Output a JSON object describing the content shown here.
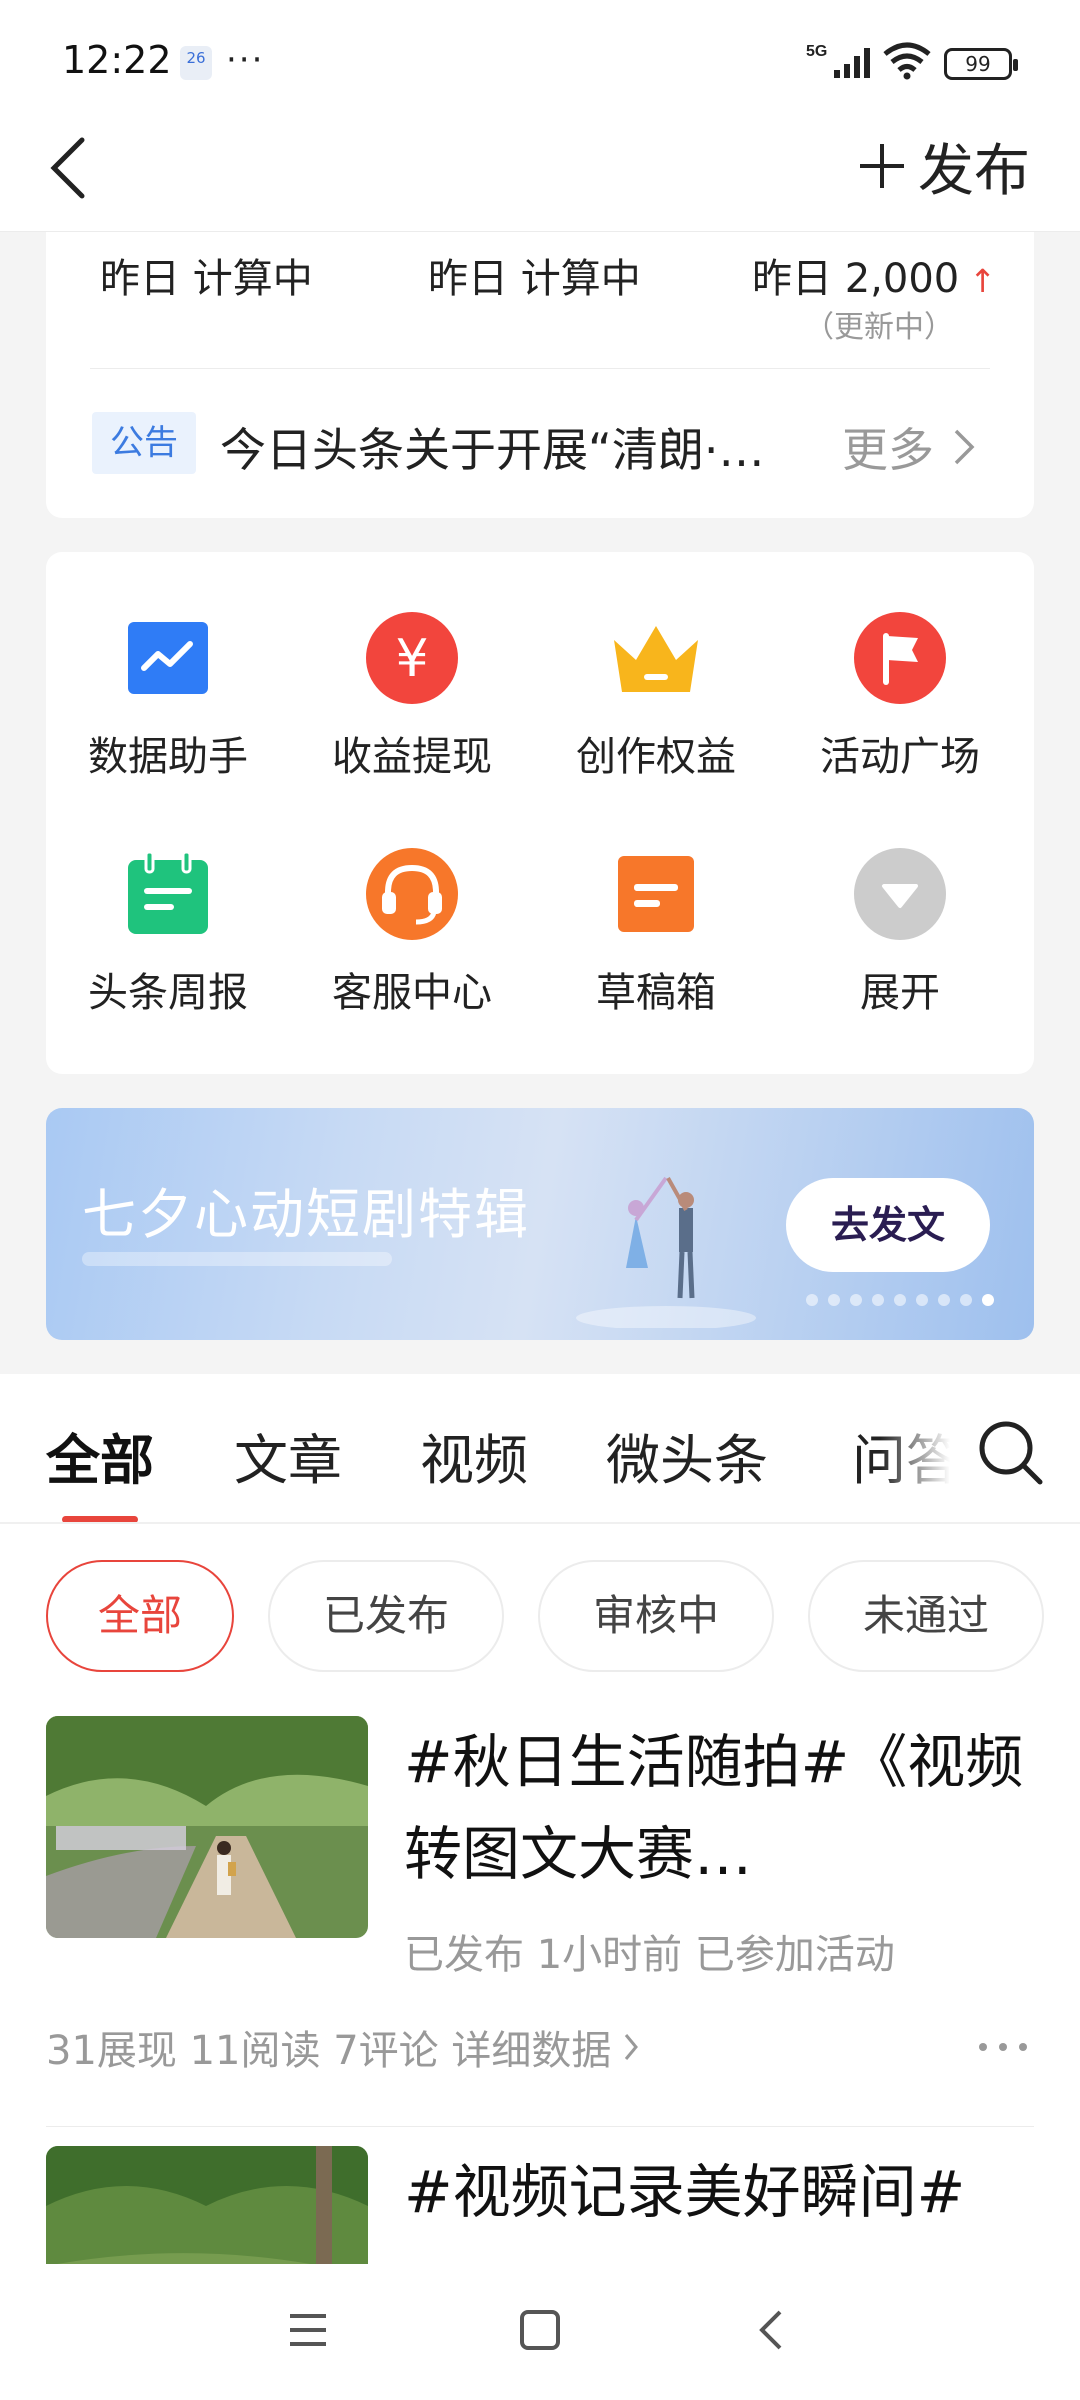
{
  "status_bar": {
    "time": "12:22",
    "calendar_day": "26",
    "dots": "···",
    "battery": "99"
  },
  "header": {
    "publish_label": "发布"
  },
  "stats": {
    "items": [
      {
        "label": "昨日 计算中"
      },
      {
        "label": "昨日 计算中"
      },
      {
        "label": "昨日 2,000"
      }
    ],
    "trend": "↑",
    "sub_note": "（更新中）"
  },
  "notice": {
    "tag": "公告",
    "text": "今日头条关于开展“清朗·…",
    "more": "更多"
  },
  "tools": [
    {
      "label": "数据助手",
      "icon": "chart-icon",
      "color": "#2f7cf6"
    },
    {
      "label": "收益提现",
      "icon": "yen-icon",
      "color": "#f2453d"
    },
    {
      "label": "创作权益",
      "icon": "crown-icon",
      "color": "#f8b51c"
    },
    {
      "label": "活动广场",
      "icon": "flag-icon",
      "color": "#f2453d"
    },
    {
      "label": "头条周报",
      "icon": "calendar-icon",
      "color": "#1fc37d"
    },
    {
      "label": "客服中心",
      "icon": "headset-icon",
      "color": "#f7772a"
    },
    {
      "label": "草稿箱",
      "icon": "draft-icon",
      "color": "#f7772a"
    },
    {
      "label": "展开",
      "icon": "expand-icon",
      "color": "#cccccc"
    }
  ],
  "banner": {
    "title": "七夕心动短剧特辑",
    "button": "去发文",
    "dot_count": 9,
    "active_dot": 8
  },
  "tabs": [
    {
      "label": "全部",
      "active": true
    },
    {
      "label": "文章"
    },
    {
      "label": "视频"
    },
    {
      "label": "微头条"
    },
    {
      "label": "问答"
    }
  ],
  "filters": [
    {
      "label": "全部",
      "active": true
    },
    {
      "label": "已发布"
    },
    {
      "label": "审核中"
    },
    {
      "label": "未通过"
    }
  ],
  "posts": [
    {
      "title": "#秋日生活随拍#《视频转图文大赛…",
      "meta": "已发布  1小时前  已参加活动",
      "stats": "31展现  11阅读  7评论  详细数据"
    },
    {
      "title": "#视频记录美好瞬间#"
    }
  ]
}
